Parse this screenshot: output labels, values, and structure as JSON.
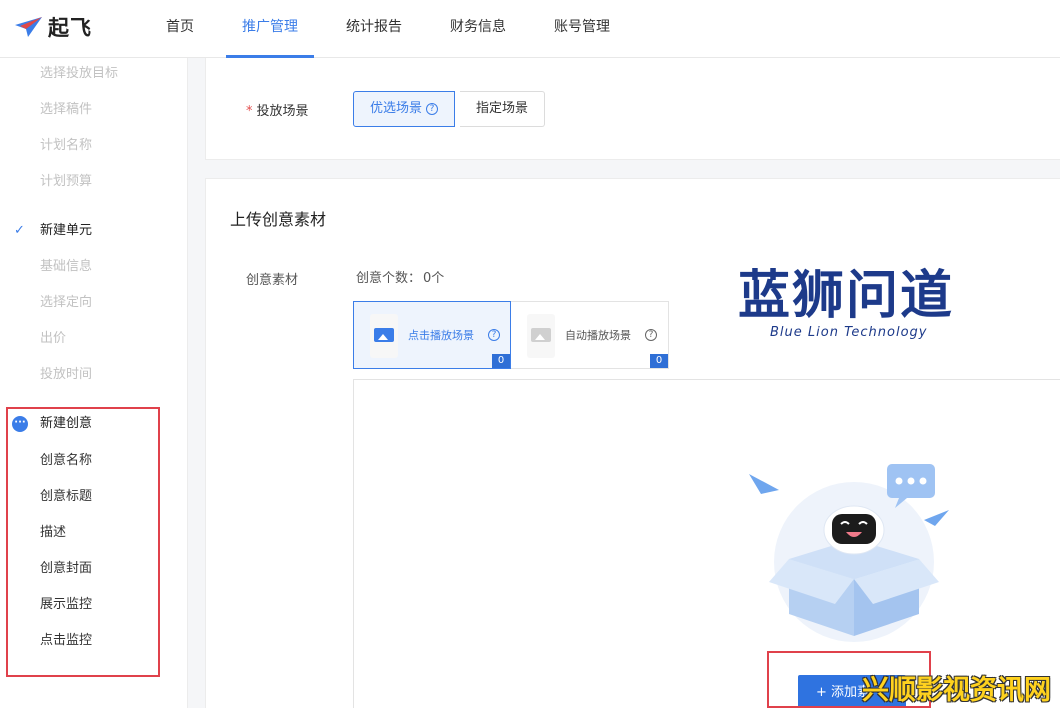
{
  "app": {
    "logo_text": "起飞"
  },
  "nav": {
    "items": [
      {
        "label": "首页"
      },
      {
        "label": "推广管理"
      },
      {
        "label": "统计报告"
      },
      {
        "label": "财务信息"
      },
      {
        "label": "账号管理"
      }
    ],
    "active_index": 1
  },
  "sidebar": {
    "group1": [
      "选择投放目标",
      "选择稿件",
      "计划名称",
      "计划预算"
    ],
    "unit_head": "新建单元",
    "group2": [
      "基础信息",
      "选择定向",
      "出价",
      "投放时间"
    ],
    "creative_head": "新建创意",
    "group3": [
      "创意名称",
      "创意标题",
      "描述",
      "创意封面",
      "展示监控",
      "点击监控"
    ]
  },
  "placement": {
    "label": "投放场景",
    "options": [
      "优选场景",
      "指定场景"
    ],
    "selected": "优选场景"
  },
  "upload": {
    "title": "上传创意素材",
    "field_label": "创意素材",
    "count_label": "创意个数：",
    "count_value": "0个",
    "scenes": [
      {
        "name": "点击播放场景",
        "count": "0"
      },
      {
        "name": "自动播放场景",
        "count": "0"
      }
    ],
    "add_button": "+ 添加素"
  },
  "watermark": {
    "title": "蓝狮问道",
    "subtitle": "Blue Lion Technology",
    "corner": "兴顺影视资讯网"
  },
  "colors": {
    "accent": "#3b7de8",
    "highlight_border": "#e0414b"
  }
}
